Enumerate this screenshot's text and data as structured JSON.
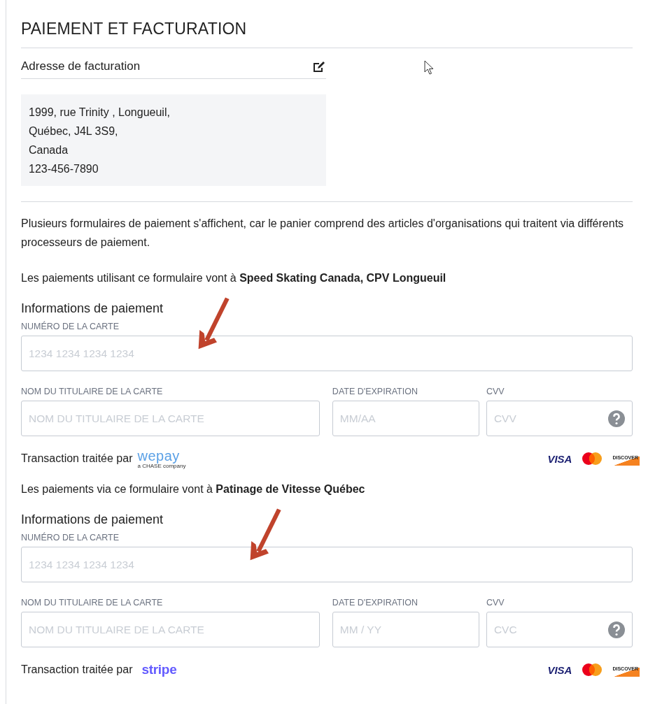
{
  "section_title": "PAIEMENT ET FACTURATION",
  "billing": {
    "title": "Adresse de facturation",
    "lines": [
      "1999, rue Trinity , Longueuil,",
      "Québec, J4L 3S9,",
      "Canada",
      "123-456-7890"
    ]
  },
  "notice": "Plusieurs formulaires de paiement s'affichent, car le panier comprend des articles d'organisations qui traitent via différents processeurs de paiement.",
  "forms": [
    {
      "sentence": "Les paiements utilisant ce formulaire vont à **Speed Skating Canada, CPV Longueuil**",
      "heading": "Informations de paiement",
      "card_number": {
        "label": "NUMÉRO DE LA CARTE",
        "placeholder": "1234 1234 1234 1234"
      },
      "holder": {
        "label": "NOM DU TITULAIRE DE LA CARTE",
        "placeholder": "NOM DU TITULAIRE DE LA CARTE"
      },
      "expiry": {
        "label": "DATE D'EXPIRATION",
        "placeholder": "MM/AA"
      },
      "cvv": {
        "label": "CVV",
        "placeholder": "CVV"
      },
      "processor_label": "Transaction traitée par",
      "processor": {
        "kind": "wepay",
        "name": "wepay",
        "tagline": "a CHASE company"
      },
      "cards": [
        {
          "kind": "visa",
          "text": "VISA"
        },
        {
          "kind": "mastercard"
        },
        {
          "kind": "discover",
          "text": "DISCOVER"
        }
      ]
    },
    {
      "sentence": "Les paiements via ce formulaire vont à **Patinage de Vitesse Québec**",
      "heading": "Informations de paiement",
      "card_number": {
        "label": "NUMÉRO DE LA CARTE",
        "placeholder": "1234 1234 1234 1234"
      },
      "holder": {
        "label": "NOM DU TITULAIRE DE LA CARTE",
        "placeholder": "NOM DU TITULAIRE DE LA CARTE"
      },
      "expiry": {
        "label": "DATE D'EXPIRATION",
        "placeholder": "MM / YY"
      },
      "cvv": {
        "label": "CVV",
        "placeholder": "CVC"
      },
      "processor_label": "Transaction traitée par",
      "processor": {
        "kind": "stripe",
        "name": "stripe"
      },
      "cards": [
        {
          "kind": "visa",
          "text": "VISA"
        },
        {
          "kind": "mastercard"
        },
        {
          "kind": "discover",
          "text": "DISCOVER"
        }
      ]
    }
  ]
}
